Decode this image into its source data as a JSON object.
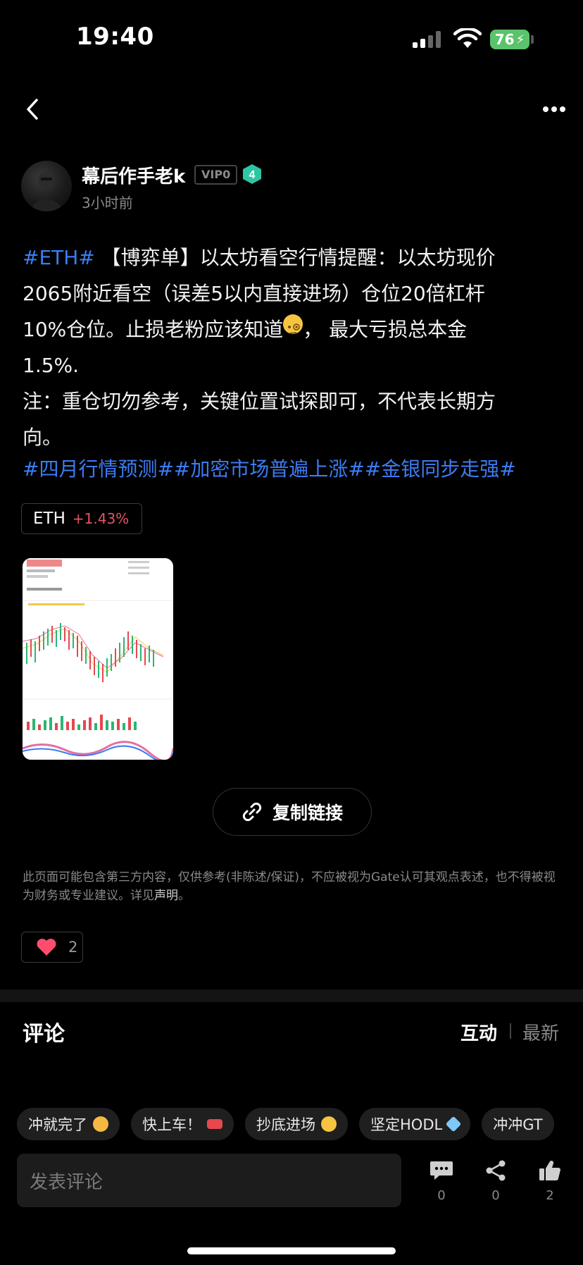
{
  "status_bar": {
    "time": "19:40",
    "battery": "76"
  },
  "post": {
    "author": "幕后作手老k",
    "vip_badge": "VIP0",
    "level": "4",
    "time_ago": "3小时前",
    "hashtag_eth": "#ETH#",
    "body_line1": " 【博弈单】以太坊看空行情提醒：以太坊现价",
    "body_line2": "2065附近看空（误差5以内直接进场）仓位20倍杠杆",
    "body_line3a": "10%仓位。止损老粉应该知道",
    "body_line3b": "， 最大亏损总本金",
    "body_line4": "1.5%.",
    "body_line5": "注：重仓切勿参考，关键位置试探即可，不代表长期方",
    "body_line6": "向。",
    "hashtags": "#四月行情预测##加密市场普遍上涨##金银同步走强#",
    "ticker": {
      "symbol": "ETH",
      "change": "+1.43%"
    },
    "copy_link": "复制链接",
    "disclaimer": "此页面可能包含第三方内容，仅供参考(非陈述/保证)，不应被视为Gate认可其观点表述，也不得被视为财务或专业建议。详见",
    "disclaimer_link": "声明",
    "disclaimer_end": "。",
    "likes": "2"
  },
  "comments": {
    "title": "评论",
    "tab_interact": "互动",
    "tab_latest": "最新",
    "chips": [
      "冲就完了",
      "快上车！",
      "抄底进场",
      "坚定HODL",
      "冲冲GT"
    ],
    "input_placeholder": "发表评论",
    "actions": [
      {
        "icon": "comment-icon",
        "count": "0"
      },
      {
        "icon": "share-icon",
        "count": "0"
      },
      {
        "icon": "thumbs-up-icon",
        "count": "2"
      }
    ]
  },
  "colors": {
    "link": "#3c7cf2",
    "price_up": "#e55368",
    "heart": "#ff4d6d"
  }
}
